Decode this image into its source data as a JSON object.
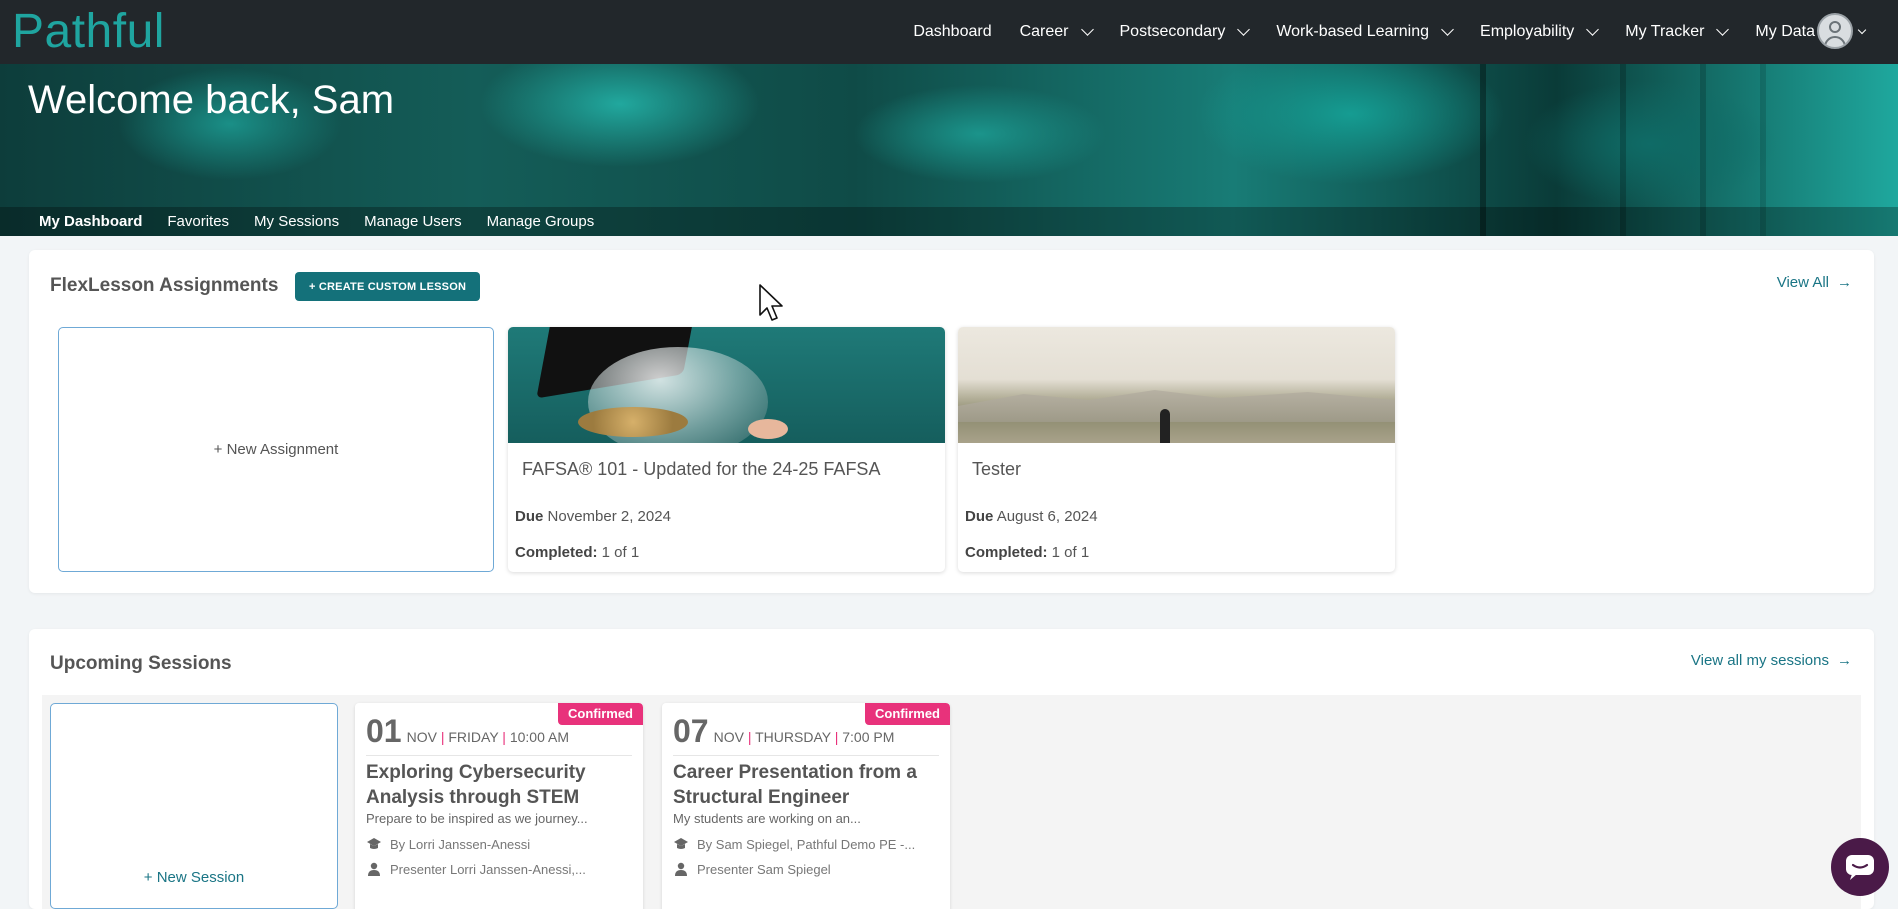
{
  "brand": {
    "logo_text": "Pathful",
    "accent": "#1fa5a0",
    "nav_bg": "#22272b"
  },
  "nav": {
    "items": [
      {
        "label": "Dashboard",
        "has_menu": false
      },
      {
        "label": "Career",
        "has_menu": true
      },
      {
        "label": "Postsecondary",
        "has_menu": true
      },
      {
        "label": "Work-based Learning",
        "has_menu": true
      },
      {
        "label": "Employability",
        "has_menu": true
      },
      {
        "label": "My Tracker",
        "has_menu": true
      },
      {
        "label": "My Data",
        "has_menu": true
      }
    ],
    "avatar_icon": "user-circle-icon"
  },
  "hero": {
    "welcome": "Welcome back, Sam",
    "tabs": [
      "My Dashboard",
      "Favorites",
      "My Sessions",
      "Manage Users",
      "Manage Groups"
    ],
    "active_tab": "My Dashboard"
  },
  "flexlessons": {
    "title": "FlexLesson Assignments",
    "create_label": "+ CREATE CUSTOM LESSON",
    "view_all": "View All",
    "new_label": "+ New Assignment",
    "due_label": "Due",
    "completed_label": "Completed:",
    "cards": [
      {
        "title": "FAFSA® 101 - Updated for the 24-25 FAFSA",
        "due": "November 2, 2024",
        "completed": "1 of 1"
      },
      {
        "title": "Tester",
        "due": "August 6, 2024",
        "completed": "1 of 1"
      }
    ]
  },
  "sessions": {
    "title": "Upcoming Sessions",
    "view_all": "View all my sessions",
    "new_label": "+ New Session",
    "badge_color": "#e8327b",
    "cards": [
      {
        "status": "Confirmed",
        "day": "01",
        "month": "NOV",
        "weekday": "FRIDAY",
        "time": "10:00 AM",
        "title": "Exploring Cybersecurity Analysis through STEM",
        "desc": "Prepare to be inspired as we journey...",
        "by": "By Lorri Janssen-Anessi",
        "presenter": "Presenter Lorri Janssen-Anessi,..."
      },
      {
        "status": "Confirmed",
        "day": "07",
        "month": "NOV",
        "weekday": "THURSDAY",
        "time": "7:00 PM",
        "title": "Career Presentation from a Structural Engineer",
        "desc": "My students are working on an...",
        "by": "By Sam Spiegel, Pathful Demo PE -...",
        "presenter": "Presenter Sam Spiegel"
      }
    ]
  },
  "chat": {
    "icon": "chat-bubble-icon"
  }
}
